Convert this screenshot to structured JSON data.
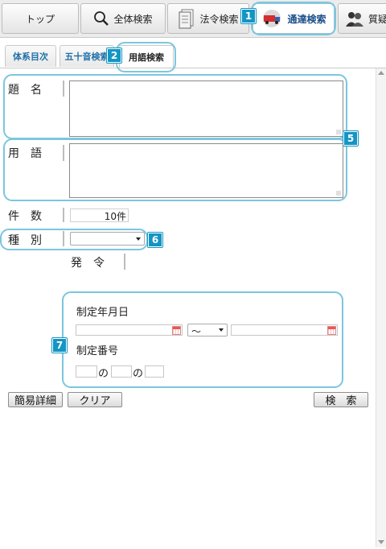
{
  "top_tabs": [
    {
      "label": "トップ",
      "icon": "none"
    },
    {
      "label": "全体検索",
      "icon": "magnifier-icon"
    },
    {
      "label": "法令検索",
      "icon": "document-icon"
    },
    {
      "label": "通達検索",
      "icon": "truck-icon"
    },
    {
      "label": "質疑",
      "icon": "people-icon"
    }
  ],
  "sub_tabs": [
    {
      "label": "体系目次"
    },
    {
      "label": "五十音検索"
    },
    {
      "label": "用語検索"
    }
  ],
  "badges": {
    "b1": "1",
    "b2": "2",
    "b5": "5",
    "b6": "6",
    "b7": "7"
  },
  "form": {
    "title_label": "題　名",
    "term_label": "用　語",
    "count_label": "件　数",
    "count_value": "10件",
    "type_label": "種　別",
    "type_selected": "",
    "issue_label": "発　令",
    "date_label": "制定年月日",
    "range_separator": "～",
    "number_label": "制定番号",
    "number_no_1": "の",
    "number_no_2": "の"
  },
  "buttons": {
    "simple_detail": "簡易詳細",
    "clear": "クリア",
    "search": "検　索"
  },
  "colors": {
    "callout": "#7cc6de",
    "badge": "#1495c4",
    "link_blue": "#1f6fa8"
  }
}
